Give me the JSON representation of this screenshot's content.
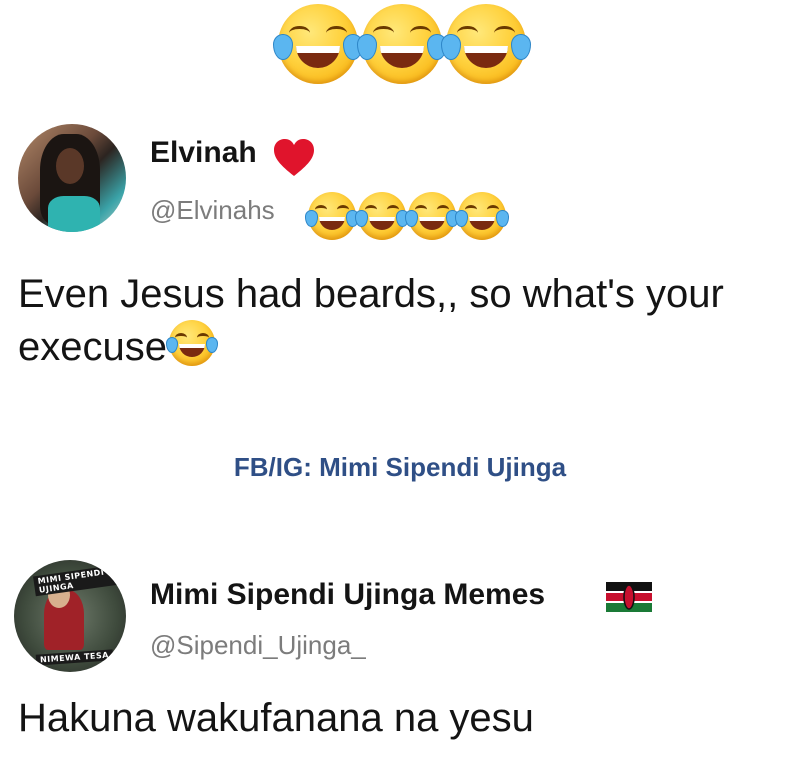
{
  "post1": {
    "name": "Elvinah",
    "handle": "@Elvinahs",
    "text": "Even Jesus had beards,, so what's your execuse"
  },
  "watermark": "FB/IG: Mimi Sipendi Ujinga",
  "post2": {
    "name": "Mimi Sipendi Ujinga Memes",
    "handle": "@Sipendi_Ujinga_",
    "text": "Hakuna wakufanana na yesu",
    "avatar_caption_top": "MIMI SIPENDI UJINGA",
    "avatar_caption_bottom": "NIMEWA TESA"
  },
  "icons": {
    "top_emoji": "face-with-tears-of-joy-icon",
    "name_badge": "red-heart-icon",
    "flag": "kenya-flag-icon"
  },
  "colors": {
    "watermark": "#2f4f86",
    "handle": "#7c7c7c",
    "heart": "#e0142c"
  }
}
